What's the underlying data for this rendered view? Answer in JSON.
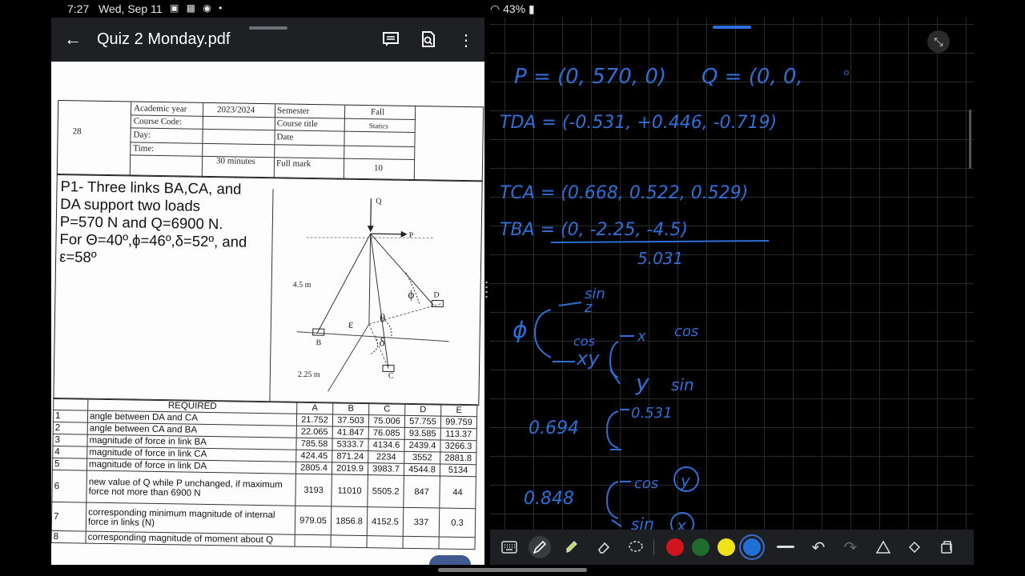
{
  "status_bar": {
    "time": "7:27",
    "date": "Wed, Sep 11",
    "battery": "43%"
  },
  "pdf_viewer": {
    "title": "Quiz 2 Monday.pdf"
  },
  "header": {
    "code": "28",
    "academic_year_label": "Academic year",
    "academic_year": "2023/2024",
    "semester_label": "Semester",
    "semester": "Fall",
    "course_code_label": "Course Code:",
    "course_title_label": "Course title",
    "course_title": "Statics",
    "day_label": "Day:",
    "date_label": "Date",
    "time_label": "Time:",
    "time": "30 minutes",
    "full_mark_label": "Full mark",
    "full_mark": "10"
  },
  "problem": {
    "lines": [
      "P1- Three links BA,CA, and",
      "DA support two loads",
      "P=570 N and Q=6900 N.",
      "For Θ=40º,ϕ=46º,δ=52º, and",
      "ε=58º"
    ],
    "fig": {
      "q": "Q",
      "p": "P",
      "d": "D",
      "b": "B",
      "c": "C",
      "dim1": "4.5 m",
      "dim2": "2.25 m",
      "phi": "ϕ",
      "theta": "θ",
      "eps": "ε",
      "delta": "δ"
    }
  },
  "table": {
    "required_label": "REQUIRED",
    "cols": [
      "A",
      "B",
      "C",
      "D",
      "E"
    ],
    "rows": [
      {
        "n": "1",
        "label": "angle between DA and CA",
        "v": [
          "21.752",
          "37.503",
          "75.006",
          "57.755",
          "99.759"
        ]
      },
      {
        "n": "2",
        "label": "angle between CA and BA",
        "v": [
          "22.065",
          "41.847",
          "76.085",
          "93.585",
          "113.37"
        ]
      },
      {
        "n": "3",
        "label": "magnitude of force in link BA",
        "v": [
          "785.58",
          "5333.7",
          "4134.6",
          "2439.4",
          "3266.3"
        ]
      },
      {
        "n": "4",
        "label": "magnitude of force in link CA",
        "v": [
          "424.45",
          "871.24",
          "2234",
          "3552",
          "2881.8"
        ]
      },
      {
        "n": "5",
        "label": "magnitude of force in link DA",
        "v": [
          "2805.4",
          "2019.9",
          "3983.7",
          "4544.8",
          "5134"
        ]
      },
      {
        "n": "6",
        "label": "new value of Q while P unchanged, if maximum force not more than 6900 N",
        "v": [
          "3193",
          "11010",
          "5505.2",
          "847",
          "44"
        ]
      },
      {
        "n": "7",
        "label": "corresponding minimum magnitude of internal force in links (N)",
        "v": [
          "979.05",
          "1856.8",
          "4152.5",
          "337",
          "0.3"
        ]
      },
      {
        "n": "8",
        "label": "corresponding magnitude of moment about Q",
        "v": [
          "",
          "",
          "",
          "",
          ""
        ]
      }
    ]
  },
  "notes": {
    "p": "P = (0, 570, 0)",
    "q": "Q = (0, 0,",
    "tda": "TDA = (-0.531, +0.446, -0.719)",
    "tca": "TCA = (0.668, 0.522, 0.529)",
    "tba": "TBA = (0, -2.25, -4.5)",
    "tba_den": "5.031",
    "sin1": "sin",
    "z": "z",
    "phi": "ϕ",
    "cos1": "cos",
    "x": "x",
    "cos2": "cos",
    "xy": "xy",
    "y": "y",
    "sin2": "sin",
    "v694": "0.694",
    "v531": "0.531",
    "v848": "0.848",
    "cos3": "cos",
    "y2": "y",
    "sin3": "sin",
    "x2": "x"
  },
  "colors": {
    "ink": "#2f6fd6",
    "red": "#d0141e",
    "green": "#1f6b2d",
    "yellow": "#f0e21a",
    "blue": "#1f6fd6",
    "toolbar": "#1e1f22",
    "appbar": "#1f2024"
  },
  "toolbar_icons": [
    "keyboard-icon",
    "pen-icon",
    "highlighter-icon",
    "eraser-icon",
    "lasso-icon",
    "color-red",
    "color-green",
    "color-yellow",
    "color-blue",
    "line-width-icon",
    "undo-icon",
    "redo-icon",
    "shape-icon",
    "fill-icon",
    "more-icon"
  ]
}
